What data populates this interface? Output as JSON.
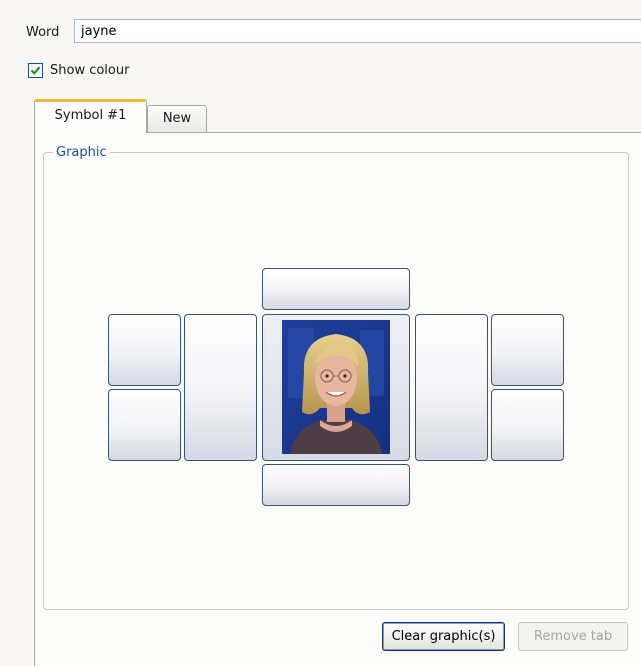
{
  "word": {
    "label": "Word",
    "value": "jayne"
  },
  "show_colour": {
    "label": "Show colour",
    "checked": true
  },
  "tabs": [
    {
      "label": "Symbol #1",
      "active": true
    },
    {
      "label": "New",
      "active": false
    }
  ],
  "graphic": {
    "legend": "Graphic"
  },
  "buttons": {
    "clear": "Clear graphic(s)",
    "remove": "Remove tab"
  },
  "colors": {
    "legend": "#1c4fa0",
    "active_tab_accent": "#f0b53a",
    "slot_border": "#36557a"
  }
}
